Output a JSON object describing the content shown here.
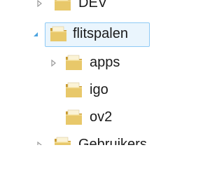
{
  "tree": {
    "items": [
      {
        "label": "DEV",
        "expander": "collapsed",
        "icon": "folder-icon",
        "state": "partially-visible"
      },
      {
        "label": "flitspalen",
        "expander": "expanded",
        "icon": "folder-icon",
        "state": "selected"
      },
      {
        "label": "apps",
        "expander": "collapsed",
        "icon": "folder-icon",
        "state": "normal"
      },
      {
        "label": "igo",
        "expander": "none",
        "icon": "folder-icon",
        "state": "normal"
      },
      {
        "label": "ov2",
        "expander": "none",
        "icon": "folder-icon",
        "state": "normal"
      },
      {
        "label": "Gebruikers",
        "expander": "collapsed",
        "icon": "folder-icon",
        "state": "partially-visible"
      }
    ]
  },
  "colors": {
    "selection_border": "#8fcaf5",
    "selection_fill": "#eaf5fd",
    "expander_collapsed": "#9a9a9a",
    "expander_expanded": "#4aa3df",
    "folder_body": "#e8c86a",
    "folder_shadow": "#c99a2e",
    "folder_paper": "#fbf3d6"
  }
}
